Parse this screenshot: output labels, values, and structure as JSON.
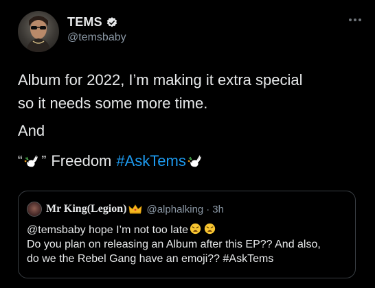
{
  "author": {
    "display_name": "TEMS",
    "handle": "@temsbaby",
    "verified_icon": "verified-badge-icon",
    "avatar_icon": "profile-avatar"
  },
  "tweet": {
    "line1": "Album for 2022, I’m making it extra special",
    "line2": "so it needs some more time.",
    "line3": "And",
    "open_quote": "“",
    "close_quote": "”",
    "word_freedom": "Freedom",
    "hashtag": "#AskTems",
    "dove_icon": "dove-emoji",
    "colors": {
      "text": "#e7e9ea",
      "hashtag": "#1d9bf0",
      "secondary": "#8b98a5",
      "background": "#000000"
    }
  },
  "more_menu_icon": "more-options-icon",
  "quoted": {
    "display_name": "Mr King(Legion)",
    "crown_icon": "crown-emoji",
    "handle": "@alphalking",
    "separator": "·",
    "time": "3h",
    "line1_mention": "@temsbaby",
    "line1_text": "hope I’m not too late",
    "line2": "Do you plan on releasing an Album after this EP?? And also,",
    "line3": "do we the Rebel Gang have an emoji?? #AskTems",
    "emoji": "weary-face-emoji"
  }
}
